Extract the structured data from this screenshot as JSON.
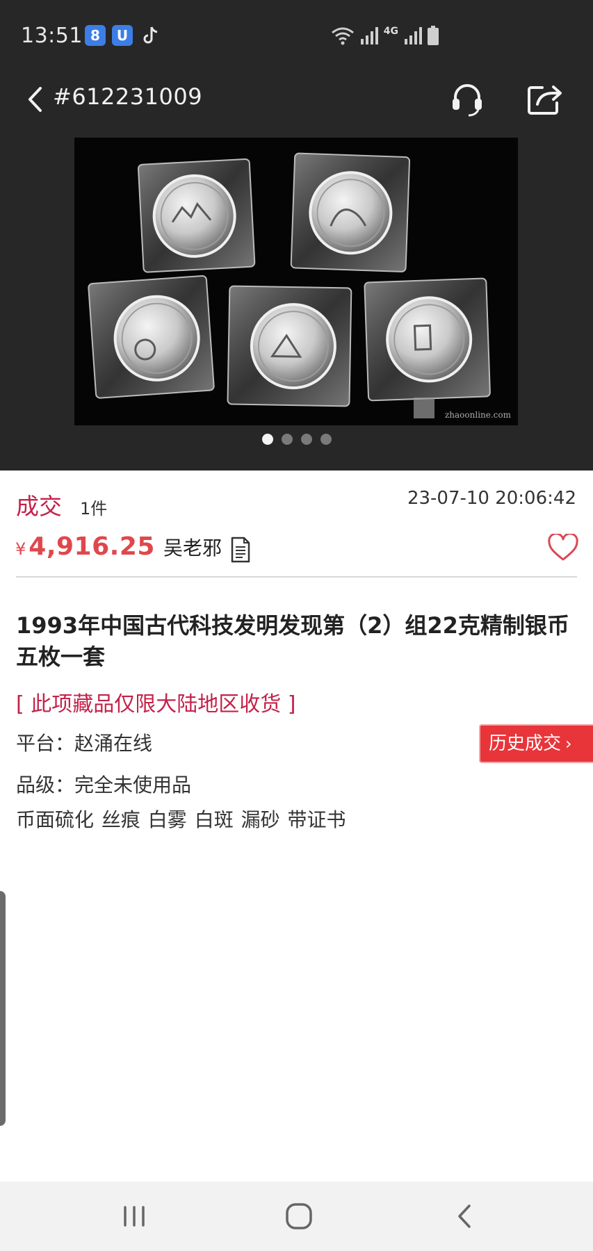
{
  "status_bar": {
    "time": "13:51",
    "app_badges": [
      "8",
      "U"
    ],
    "network": "4G"
  },
  "header": {
    "lot_number": "#612231009",
    "icons": [
      "back-icon",
      "customer-service-icon",
      "share-icon"
    ]
  },
  "carousel": {
    "watermark": "zhaoonline.com",
    "page_count": 4,
    "active_index": 0
  },
  "deal": {
    "status_label": "成交",
    "quantity": "1件",
    "time": "23-07-10 20:06:42",
    "currency_symbol": "¥",
    "price": "4,916.25",
    "buyer": "吴老邪"
  },
  "item": {
    "title": "1993年中国古代科技发明发现第（2）组22克精制银币五枚一套",
    "restriction": "[ 此项藏品仅限大陆地区收货 ]",
    "platform": "平台：赵涌在线",
    "grade": "品级：完全未使用品",
    "tags": "币面硫化 丝痕 白雾 白斑 漏砂 带证书"
  },
  "actions": {
    "history_label": "历史成交",
    "history_chevron": "›"
  },
  "colors": {
    "header_bg": "#272727",
    "accent_red": "#c4224a",
    "price_red": "#e0474c",
    "button_red": "#e8353a"
  }
}
